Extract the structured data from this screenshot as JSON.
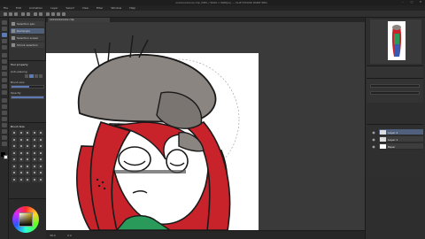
{
  "app": {
    "title": "xxxxxxxxxxxx.clip (38% / 5000 x 3000px) — CLIP STUDIO PAINT PRO"
  },
  "window_controls": [
    "–",
    "□",
    "✕"
  ],
  "menu": [
    "File",
    "Edit",
    "Animation",
    "Layer",
    "Select",
    "View",
    "Filter",
    "Window",
    "Help"
  ],
  "canvas": {
    "tab_label": "xxxxxxxxxxxx.clip",
    "status_zoom": "38.4",
    "status_coords": "0.0"
  },
  "subtool": {
    "items": [
      "Selection pen",
      "Rectangle",
      "Selection eraser",
      "Shrink selection"
    ]
  },
  "tool_property": {
    "title": "Tool property",
    "items": [
      "Anti-aliasing",
      "Brush size",
      "Opacity"
    ],
    "brush_size_fraction": 0.55
  },
  "brush_size": {
    "title": "Brush Size"
  },
  "layers": {
    "items": [
      "Layer 2",
      "Layer 1",
      "Paper"
    ]
  },
  "colors": {
    "accent": "#5a7bb5",
    "hair": "#c8222a",
    "hat": "#8a8580",
    "jacket": "#2a9a5a"
  }
}
